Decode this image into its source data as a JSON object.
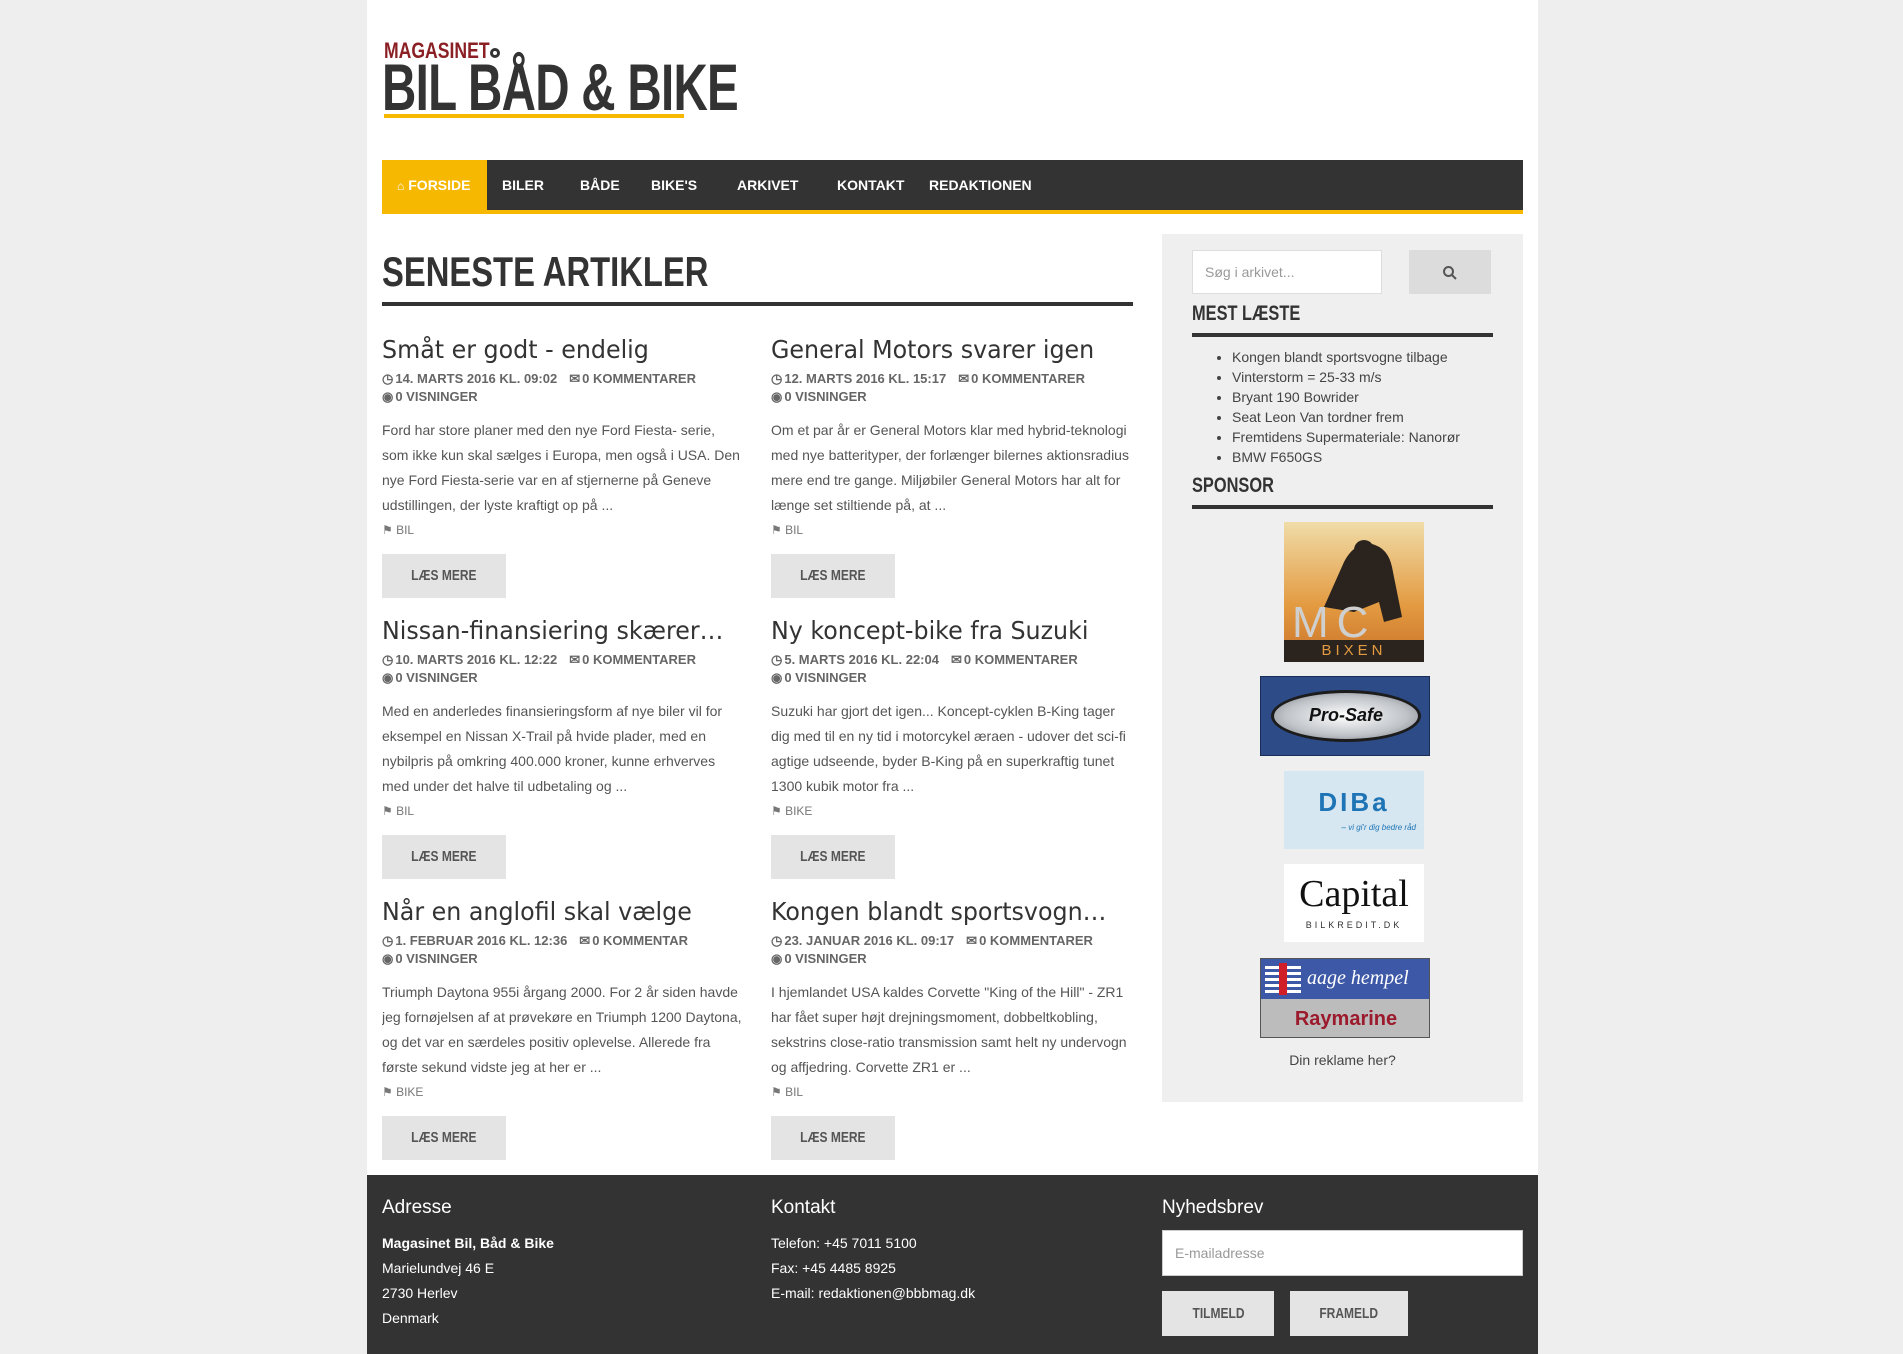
{
  "logo": {
    "small": "MAGASINET",
    "big": "BIL BÅD & BIKE"
  },
  "nav": {
    "items": [
      "FORSIDE",
      "BILER",
      "BÅDE",
      "BIKE'S",
      "ARKIVET",
      "KONTAKT",
      "REDAKTIONEN"
    ],
    "active": "FORSIDE"
  },
  "main": {
    "title": "SENESTE ARTIKLER",
    "articles": [
      {
        "title": "Småt er godt - endelig",
        "date": "14. MARTS 2016 KL. 09:02",
        "comments": "0 KOMMENTARER",
        "views": "0 VISNINGER",
        "excerpt": "Ford har store planer med den nye Ford Fiesta- serie, som ikke kun skal sælges i Europa, men også i USA. Den nye Ford Fiesta-serie var en af stjernerne på Geneve udstillingen, der lyste kraftigt op på ...",
        "tag": "BIL",
        "read_more": "LÆS MERE"
      },
      {
        "title": "General Motors svarer igen",
        "date": "12. MARTS 2016 KL. 15:17",
        "comments": "0 KOMMENTARER",
        "views": "0 VISNINGER",
        "excerpt": "Om et par år er General Motors klar med hybrid-teknologi med nye batterityper, der forlænger bilernes aktionsradius mere end tre gange. Miljøbiler General Motors har alt for længe set stiltiende på, at ...",
        "tag": "BIL",
        "read_more": "LÆS MERE"
      },
      {
        "title": "Nissan-finansiering skærer i ...",
        "date": "10. MARTS 2016 KL. 12:22",
        "comments": "0 KOMMENTARER",
        "views": "0 VISNINGER",
        "excerpt": "Med en anderledes finansieringsform af nye biler vil for eksempel en Nissan X-Trail på hvide plader, med en nybilpris på omkring 400.000 kroner, kunne erhverves med under det halve til udbetaling og ...",
        "tag": "BIL",
        "read_more": "LÆS MERE"
      },
      {
        "title": "Ny koncept-bike fra Suzuki",
        "date": "5. MARTS 2016 KL. 22:04",
        "comments": "0 KOMMENTARER",
        "views": "0 VISNINGER",
        "excerpt": "Suzuki har gjort det igen... Koncept-cyklen B-King tager dig med til en ny tid i motorcykel æraen - udover det sci-fi agtige udseende, byder B-King på en superkraftig tunet 1300 kubik motor fra ...",
        "tag": "BIKE",
        "read_more": "LÆS MERE"
      },
      {
        "title": "Når en anglofil skal vælge",
        "date": "1. FEBRUAR 2016 KL. 12:36",
        "comments": "0 KOMMENTAR",
        "views": "0 VISNINGER",
        "excerpt": "Triumph Daytona 955i årgang 2000. For 2 år siden havde jeg fornøjelsen af at prøvekøre en Triumph 1200 Daytona, og det var en særdeles positiv oplevelse. Allerede fra første sekund vidste jeg at her er ...",
        "tag": "BIKE",
        "read_more": "LÆS MERE"
      },
      {
        "title": "Kongen blandt sportsvogne ...",
        "date": "23. JANUAR 2016 KL. 09:17",
        "comments": "0 KOMMENTARER",
        "views": "0 VISNINGER",
        "excerpt": "I hjemlandet USA kaldes Corvette \"King of the Hill\" - ZR1 har fået super højt drejningsmoment, dobbeltkobling, sekstrins close-ratio transmission samt helt ny undervogn og affjedring. Corvette ZR1 er ...",
        "tag": "BIL",
        "read_more": "LÆS MERE"
      }
    ]
  },
  "sidebar": {
    "search_placeholder": "Søg i arkivet...",
    "most_read_title": "MEST LÆSTE",
    "most_read": [
      "Kongen blandt sportsvogne tilbage",
      "Vinterstorm = 25-33 m/s",
      "Bryant 190 Bowrider",
      "Seat Leon Van tordner frem",
      "Fremtidens Supermateriale: Nanorør",
      "BMW F650GS"
    ],
    "sponsor_title": "SPONSOR",
    "sponsors": {
      "mc": "MC",
      "mc_sub": "BIXEN",
      "prosafe": "Pro-Safe",
      "diba": "DIBa",
      "diba_sub": "– vi gi'r dig bedre råd",
      "capital": "Capital",
      "capital_sub": "BILKREDIT.DK",
      "aage": "aage hempel",
      "raymarine": "Raymarine"
    },
    "sponsor_caption": "Din reklame her?"
  },
  "footer": {
    "address_title": "Adresse",
    "address": [
      "Magasinet Bil, Båd & Bike",
      "Marielundvej 46 E",
      "2730 Herlev",
      "Denmark"
    ],
    "contact_title": "Kontakt",
    "contact": [
      "Telefon: +45 7011 5100",
      "Fax: +45 4485 8925",
      "E-mail: redaktionen@bbbmag.dk"
    ],
    "newsletter_title": "Nyhedsbrev",
    "email_placeholder": "E-mailadresse",
    "subscribe": "TILMELD",
    "unsubscribe": "FRAMELD"
  },
  "colors": {
    "accent": "#f6b800",
    "dark": "#333333",
    "logo_red": "#8a1f24"
  }
}
